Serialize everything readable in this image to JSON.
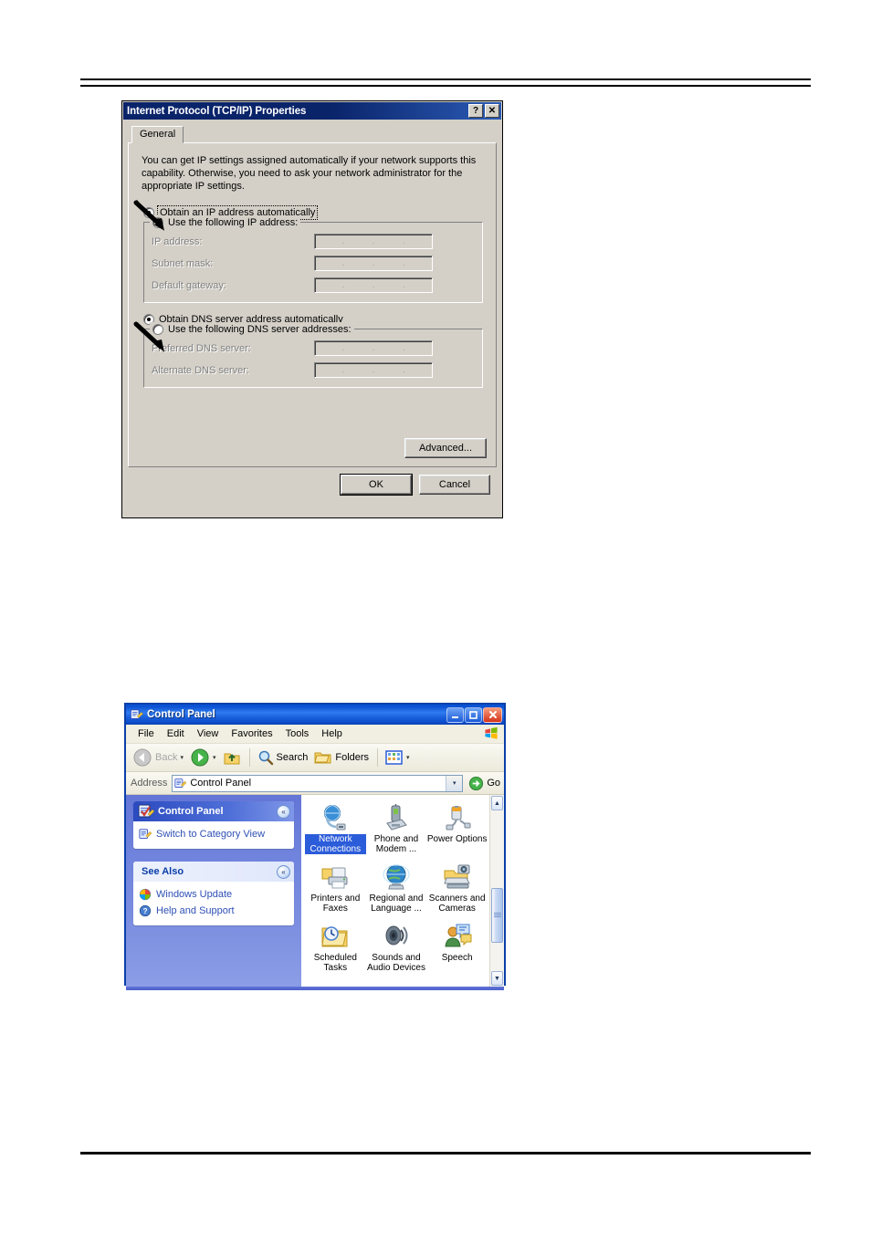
{
  "tcpip_dialog": {
    "title": "Internet Protocol (TCP/IP) Properties",
    "help_button": "?",
    "close_button": "✕",
    "tab_general": "General",
    "intro_text": "You can get IP settings assigned automatically if your network supports this capability. Otherwise, you need to ask your network administrator for the appropriate IP settings.",
    "obtain_ip_auto": "Obtain an IP address automatically",
    "use_following_ip": "Use the following IP address:",
    "ip_address_label": "IP address:",
    "subnet_mask_label": "Subnet mask:",
    "default_gateway_label": "Default gateway:",
    "ip_address_value": "",
    "subnet_mask_value": "",
    "default_gateway_value": "",
    "obtain_dns_auto": "Obtain DNS server address automatically",
    "use_following_dns": "Use the following DNS server addresses:",
    "preferred_dns_label": "Preferred DNS server:",
    "alternate_dns_label": "Alternate DNS server:",
    "preferred_dns_value": "",
    "alternate_dns_value": "",
    "advanced_button": "Advanced...",
    "ok_button": "OK",
    "cancel_button": "Cancel",
    "selected_ip_option": "obtain_ip_auto",
    "selected_dns_option": "obtain_dns_auto",
    "ip_separator": ".",
    "titlebar_color": "#0a246a",
    "face_color": "#d4d0c8"
  },
  "control_panel": {
    "title": "Control Panel",
    "window_buttons": {
      "minimize": "–",
      "maximize": "□",
      "close": "✕"
    },
    "menu": [
      "File",
      "Edit",
      "View",
      "Favorites",
      "Tools",
      "Help"
    ],
    "toolbar": {
      "back": "Back",
      "forward": "",
      "up": "",
      "search": "Search",
      "folders": "Folders",
      "views": "",
      "caret": "▾"
    },
    "address": {
      "label": "Address",
      "value": "Control Panel",
      "dropdown": "▾",
      "go": "Go"
    },
    "sidebar": {
      "panel1": {
        "title": "Control Panel",
        "chevron": "«",
        "links": [
          {
            "label": "Switch to Category View",
            "icon": "control-panel-icon"
          }
        ]
      },
      "panel2": {
        "title": "See Also",
        "chevron": "«",
        "links": [
          {
            "label": "Windows Update",
            "icon": "windows-update-icon"
          },
          {
            "label": "Help and Support",
            "icon": "help-support-icon"
          }
        ]
      }
    },
    "items": [
      {
        "label": "Network Connections",
        "icon": "network-connections-icon",
        "selected": true
      },
      {
        "label": "Phone and Modem ...",
        "icon": "phone-modem-icon",
        "selected": false
      },
      {
        "label": "Power Options",
        "icon": "power-options-icon",
        "selected": false
      },
      {
        "label": "Printers and Faxes",
        "icon": "printers-faxes-icon",
        "selected": false
      },
      {
        "label": "Regional and Language ...",
        "icon": "regional-language-icon",
        "selected": false
      },
      {
        "label": "Scanners and Cameras",
        "icon": "scanners-cameras-icon",
        "selected": false
      },
      {
        "label": "Scheduled Tasks",
        "icon": "scheduled-tasks-icon",
        "selected": false
      },
      {
        "label": "Sounds and Audio Devices",
        "icon": "sounds-audio-icon",
        "selected": false
      },
      {
        "label": "Speech",
        "icon": "speech-icon",
        "selected": false
      }
    ],
    "scrollbar": {
      "up": "▲",
      "down": "▼"
    },
    "titlebar_color": "#0a50d0",
    "selection_color": "#2b5cd9"
  }
}
